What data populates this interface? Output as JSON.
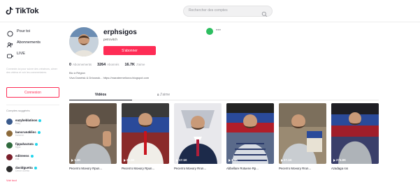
{
  "app": {
    "brand": "TikTok"
  },
  "header": {
    "search_placeholder": "Rechercher des comptes"
  },
  "sidebar": {
    "nav": [
      {
        "label": "Pour toi",
        "icon": "home-icon"
      },
      {
        "label": "Abonnements",
        "icon": "following-icon"
      },
      {
        "label": "LIVE",
        "icon": "live-icon"
      }
    ],
    "hint": "Connecte-toi pour suivre des créateurs, aimer des vidéos et voir les commentaires.",
    "login_label": "Connexion",
    "suggested_title": "Comptes suggérés",
    "accounts": [
      {
        "name": "eazybeblatinos",
        "sub": "eazy",
        "color": "#3a5a8c"
      },
      {
        "name": "bancrun4klinc",
        "sub": "bancrun",
        "color": "#8c6a3a"
      },
      {
        "name": "fippahactata",
        "sub": "fippa",
        "color": "#2f6a3d"
      },
      {
        "name": "editreens",
        "sub": "edit",
        "color": "#7a1f2b"
      },
      {
        "name": "davidguetta",
        "sub": "David Guetta",
        "color": "#2b2b2b"
      }
    ],
    "see_all": "Voir tout"
  },
  "profile": {
    "username": "erphsigos",
    "nickname": "petrovitch",
    "follow_label": "S'abonner",
    "more": "•••",
    "stats": [
      {
        "num": "0",
        "label": "Abonnements"
      },
      {
        "num": "3264",
        "label": "Abonnés"
      },
      {
        "num": "16.7K",
        "label": "J'aime"
      }
    ],
    "bio_line1": "Bio à Région",
    "bio_line2": "Viva Donetsk & Drixanok... https://maratermeliorov.blogspot.com"
  },
  "tabs": {
    "videos": "Vidéos",
    "liked": "J'aime"
  },
  "videos": [
    {
      "views": "1.2K",
      "caption": "Ресепто Моногу Rpun...",
      "bg": "#7a6a5a",
      "shirt": "#b8bcc0"
    },
    {
      "views": "21.3K",
      "caption": "Ресепто Моногу Rpun...",
      "bg": "#8a2a2a",
      "shirt": "#f0eee8"
    },
    {
      "views": "17.1K",
      "caption": "Ресепто Моногу Rrun...",
      "bg": "#e8e8ec",
      "shirt": "#1c2a4a"
    },
    {
      "views": "3.9K",
      "caption": "Abbellare Rotuene Rp...",
      "bg": "#5a6a8a",
      "shirt": "#d8dde4"
    },
    {
      "views": "27.1K",
      "caption": "Ресепто Моногу Rrun...",
      "bg": "#9a8a72",
      "shirt": "#c9cdd1"
    },
    {
      "views": "274.8K",
      "caption": "Azadaga ros",
      "bg": "#3a3f6a",
      "shirt": "#aeb3b8"
    }
  ],
  "colors": {
    "accent": "#fe2c55",
    "share": "#2dbe60",
    "verified": "#20d5ec"
  }
}
